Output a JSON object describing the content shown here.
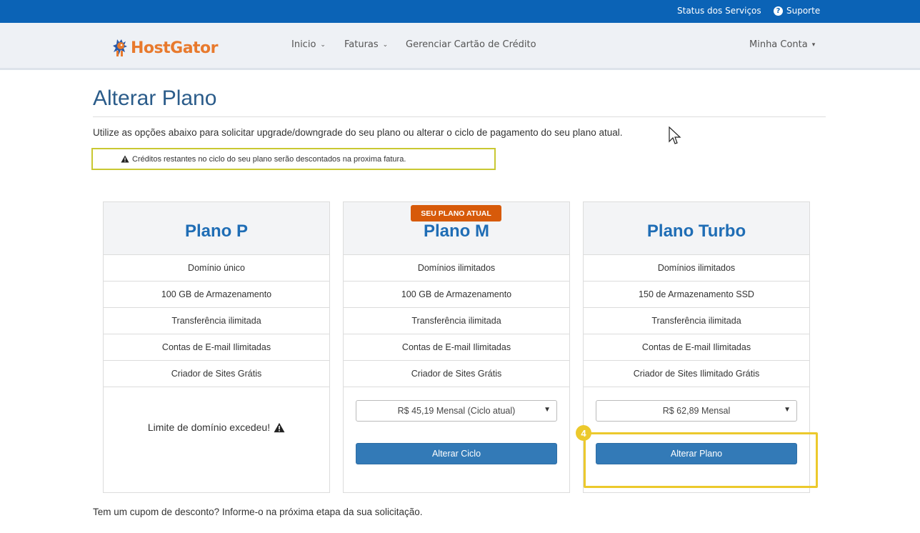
{
  "topbar": {
    "status_label": "Status dos Serviços",
    "support_label": "Suporte"
  },
  "navbar": {
    "logo_text": "HostGator",
    "items": [
      {
        "label": "Inicio"
      },
      {
        "label": "Faturas"
      },
      {
        "label": "Gerenciar Cartão de Crédito"
      }
    ],
    "account_label": "Minha Conta"
  },
  "page": {
    "title": "Alterar Plano",
    "intro": "Utilize as opções abaixo para solicitar upgrade/downgrade do seu plano ou alterar o ciclo de pagamento do seu plano atual.",
    "alert": "Créditos restantes no ciclo do seu plano serão descontados na proxima fatura.",
    "coupon_note": "Tem um cupom de desconto? Informe-o na próxima etapa da sua solicitação."
  },
  "plans": [
    {
      "name": "Plano P",
      "features": [
        "Domínio único",
        "100 GB de Armazenamento",
        "Transferência ilimitada",
        "Contas de E-mail Ilimitadas",
        "Criador de Sites Grátis"
      ],
      "limit_message": "Limite de domínio excedeu!"
    },
    {
      "name": "Plano M",
      "badge": "SEU PLANO ATUAL",
      "features": [
        "Domínios ilimitados",
        "100 GB de Armazenamento",
        "Transferência ilimitada",
        "Contas de E-mail Ilimitadas",
        "Criador de Sites Grátis"
      ],
      "select_value": "R$ 45,19 Mensal (Ciclo atual)",
      "button_label": "Alterar Ciclo"
    },
    {
      "name": "Plano Turbo",
      "features": [
        "Domínios ilimitados",
        "150 de Armazenamento SSD",
        "Transferência ilimitada",
        "Contas de E-mail Ilimitadas",
        "Criador de Sites Ilimitado Grátis"
      ],
      "select_value": "R$ 62,89 Mensal",
      "button_label": "Alterar Plano"
    }
  ],
  "annotation": {
    "step_number": "4"
  },
  "colors": {
    "topbar": "#0b63b6",
    "brand_orange": "#e87a2d",
    "plan_title": "#1f6db5",
    "button": "#337ab7",
    "badge": "#d75a0a",
    "highlight": "#ecc92c",
    "alert_border": "#c9c832"
  },
  "icons": [
    "question-circle-icon",
    "gator-logo-icon",
    "chevron-down-icon",
    "warning-icon",
    "mouse-cursor-icon"
  ]
}
